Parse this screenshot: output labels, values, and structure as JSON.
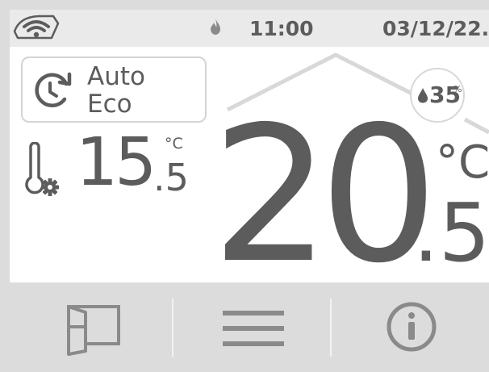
{
  "status": {
    "time": "11:00",
    "date": "03/12/22.",
    "icons": {
      "wifi": "wifi-icon",
      "flame": "flame-icon"
    }
  },
  "mode": {
    "line1": "Auto",
    "line2": "Eco",
    "icon": "schedule-clock-icon"
  },
  "humidity": {
    "value": "35",
    "unit": "%",
    "icon": "water-drop-icon"
  },
  "setpoint": {
    "integer": "15",
    "decimal": ".5",
    "unit": "°C",
    "icon": "thermometer-gear-icon"
  },
  "current_temp": {
    "integer": "20",
    "decimal": ".5",
    "unit": "°C"
  },
  "nav": {
    "items": [
      {
        "icon": "window-icon"
      },
      {
        "icon": "menu-icon"
      },
      {
        "icon": "info-icon"
      }
    ]
  },
  "colors": {
    "text": "#5c5c5c",
    "statusbar": "#eaeaea",
    "navbar": "#dcdcdc",
    "roof_line": "#d8d8d8"
  }
}
